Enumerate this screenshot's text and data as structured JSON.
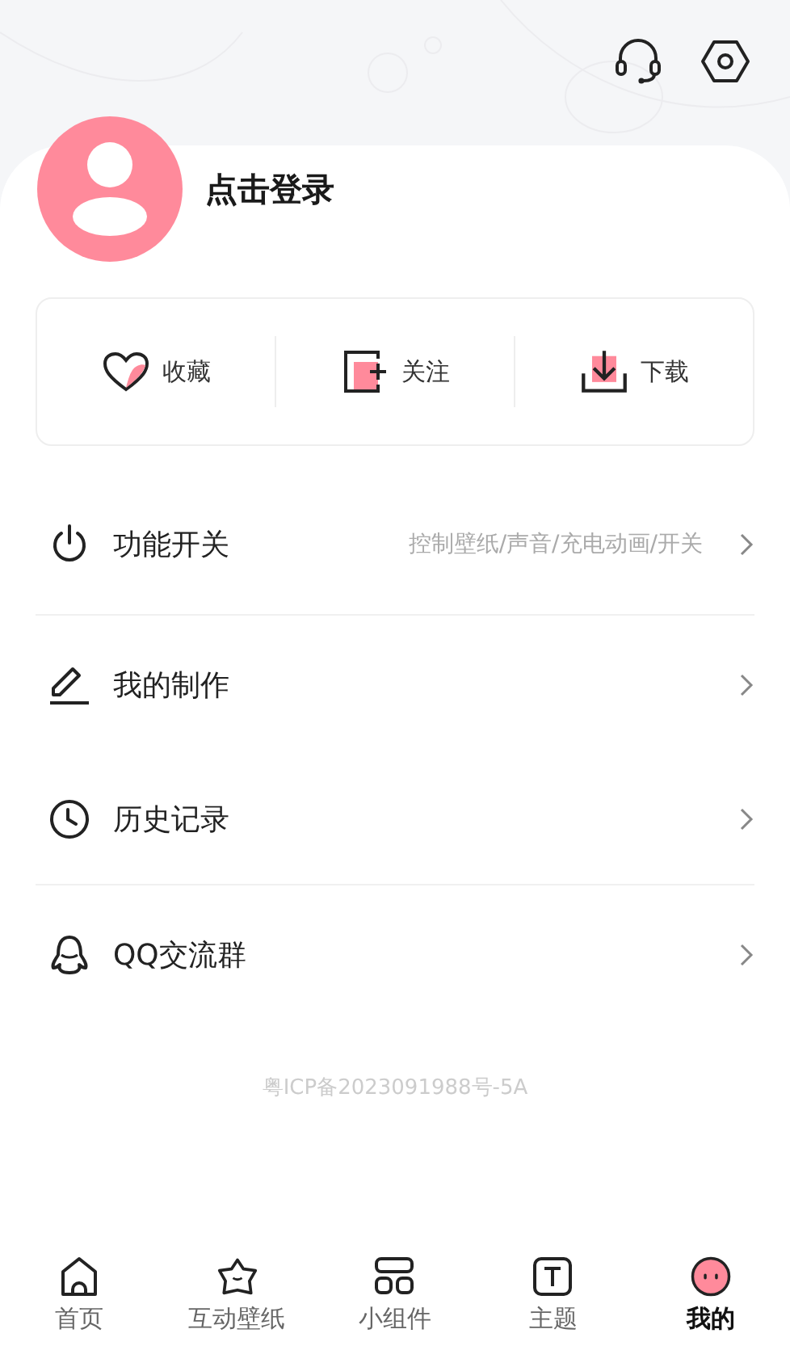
{
  "profile": {
    "login": "点击登录"
  },
  "quick_actions": [
    {
      "kind": "favorite",
      "label": "收藏"
    },
    {
      "kind": "follow",
      "label": "关注"
    },
    {
      "kind": "download",
      "label": "下载"
    }
  ],
  "menu_groups": [
    {
      "items": [
        {
          "kind": "power",
          "label": "功能开关",
          "detail": "控制壁纸/声音/充电动画/开关"
        }
      ]
    },
    {
      "items": [
        {
          "kind": "edit",
          "label": "我的制作"
        },
        {
          "kind": "history",
          "label": "历史记录"
        }
      ]
    },
    {
      "items": [
        {
          "kind": "qq",
          "label": "QQ交流群"
        }
      ]
    }
  ],
  "footer": {
    "icp": "粤ICP备2023091988号-5A"
  },
  "tabs": [
    {
      "kind": "home",
      "label": "首页",
      "selected": false
    },
    {
      "kind": "wallpaper",
      "label": "互动壁纸",
      "selected": false
    },
    {
      "kind": "widget",
      "label": "小组件",
      "selected": false
    },
    {
      "kind": "theme",
      "label": "主题",
      "selected": false
    },
    {
      "kind": "mine",
      "label": "我的",
      "selected": true
    }
  ]
}
